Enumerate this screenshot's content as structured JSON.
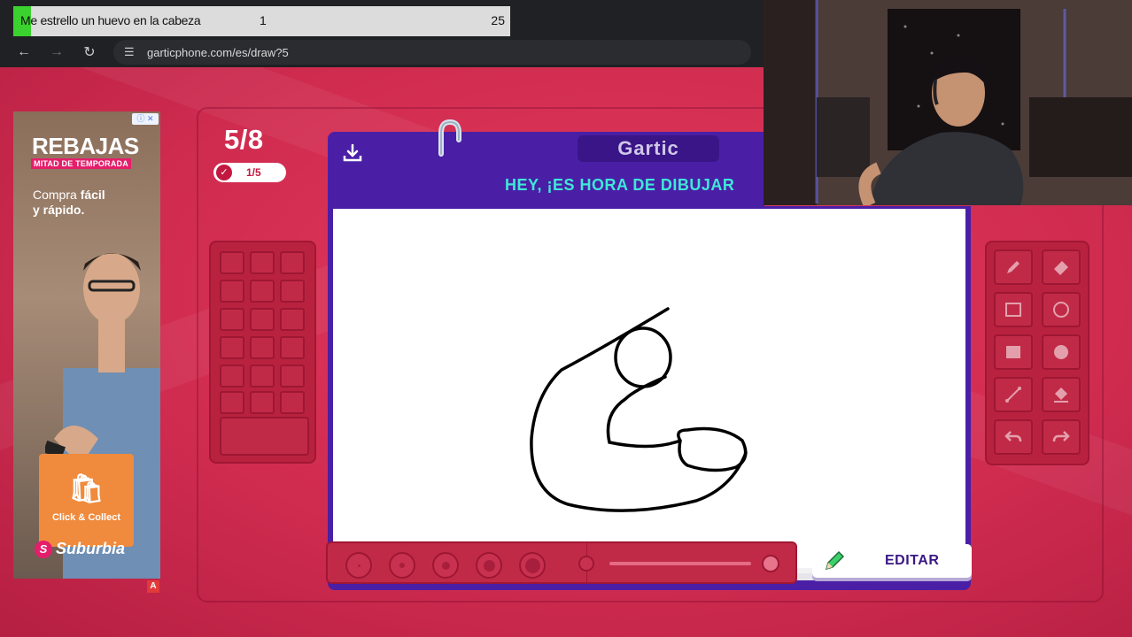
{
  "overlay": {
    "title": "Me estrello un huevo en la cabeza",
    "count": "1",
    "total": "25"
  },
  "browser": {
    "url": "garticphone.com/es/draw?5",
    "icons": [
      "back-arrow-icon",
      "forward-arrow-icon",
      "reload-icon",
      "site-settings-icon"
    ]
  },
  "ad": {
    "title": "REBAJAS",
    "subtitle": "MITAD DE TEMPORADA",
    "copy_line1": "Compra ",
    "copy_bold1": "fácil",
    "copy_line2": "y rápido.",
    "cta": "Click & Collect",
    "brand": "Suburbia",
    "brand_initial": "S",
    "corner_mark": "A"
  },
  "game": {
    "round": "5/8",
    "progress": "1/5",
    "logo": "Gartic",
    "heading": "HEY, ¡ES HORA DE DIBUJAR",
    "edit_button": "EDITAR",
    "colors": {
      "background": "#d02c50",
      "board": "#4a1fa6",
      "heading_text": "#3ee8d7",
      "button_text": "#3a1784"
    }
  },
  "tools": [
    "pencil-icon",
    "eraser-icon",
    "rectangle-outline-icon",
    "ellipse-outline-icon",
    "rectangle-filled-icon",
    "ellipse-filled-icon",
    "line-icon",
    "fill-bucket-icon",
    "undo-icon",
    "redo-icon"
  ]
}
